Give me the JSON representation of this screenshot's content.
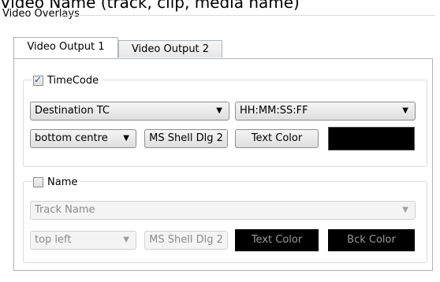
{
  "header": {
    "caption": "Video Name (track, clip, media name)",
    "group_title": "Video Overlays"
  },
  "tabs": [
    {
      "label": "Video Output 1",
      "active": true
    },
    {
      "label": "Video Output 2",
      "active": false
    }
  ],
  "timecode": {
    "label": "TimeCode",
    "checked": true,
    "source": {
      "value": "Destination TC"
    },
    "format": {
      "value": "HH:MM:SS:FF"
    },
    "position": {
      "value": "bottom centre"
    },
    "font_button": "MS Shell Dlg 2",
    "text_color_button": "Text Color",
    "swatch_color": "#000000"
  },
  "name": {
    "label": "Name",
    "checked": false,
    "source": {
      "value": "Track Name"
    },
    "position": {
      "value": "top left"
    },
    "font_button": "MS Shell Dlg 2",
    "text_color_button": "Text Color",
    "bck_color_button": "Bck Color"
  },
  "icons": {
    "dropdown": "chevron-down-icon",
    "check": "checkmark-icon"
  }
}
